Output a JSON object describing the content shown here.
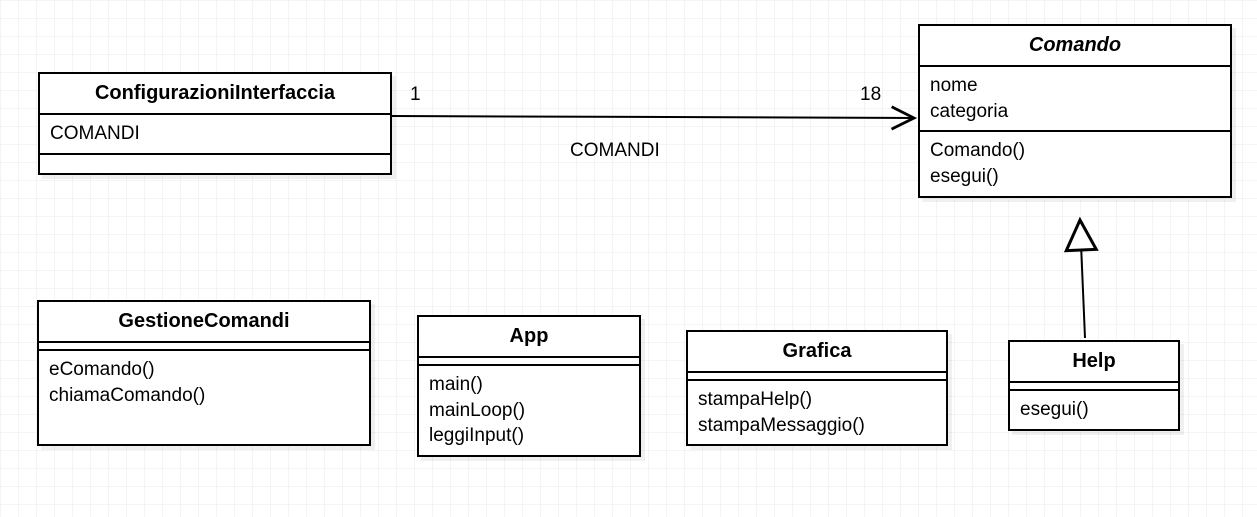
{
  "diagram_type": "UML class diagram",
  "classes": {
    "configurazioni_interfaccia": {
      "name": "ConfigurazioniInterfaccia",
      "abstract": false,
      "attributes": [
        "COMANDI"
      ],
      "operations": []
    },
    "comando": {
      "name": "Comando",
      "abstract": true,
      "attributes": [
        "nome",
        "categoria"
      ],
      "operations": [
        "Comando()",
        "esegui()"
      ]
    },
    "gestione_comandi": {
      "name": "GestioneComandi",
      "abstract": false,
      "attributes": [],
      "operations": [
        "eComando()",
        "chiamaComando()"
      ]
    },
    "app": {
      "name": "App",
      "abstract": false,
      "attributes": [],
      "operations": [
        "main()",
        "mainLoop()",
        "leggiInput()"
      ]
    },
    "grafica": {
      "name": "Grafica",
      "abstract": false,
      "attributes": [],
      "operations": [
        "stampaHelp()",
        "stampaMessaggio()"
      ]
    },
    "help": {
      "name": "Help",
      "abstract": false,
      "attributes": [],
      "operations": [
        "esegui()"
      ]
    }
  },
  "associations": {
    "comandi_assoc": {
      "label": "COMANDI",
      "mult_source": "1",
      "mult_target": "18",
      "from": "ConfigurazioniInterfaccia",
      "to": "Comando",
      "kind": "navigable-association"
    }
  },
  "generalizations": {
    "help_comando": {
      "child": "Help",
      "parent": "Comando"
    }
  }
}
